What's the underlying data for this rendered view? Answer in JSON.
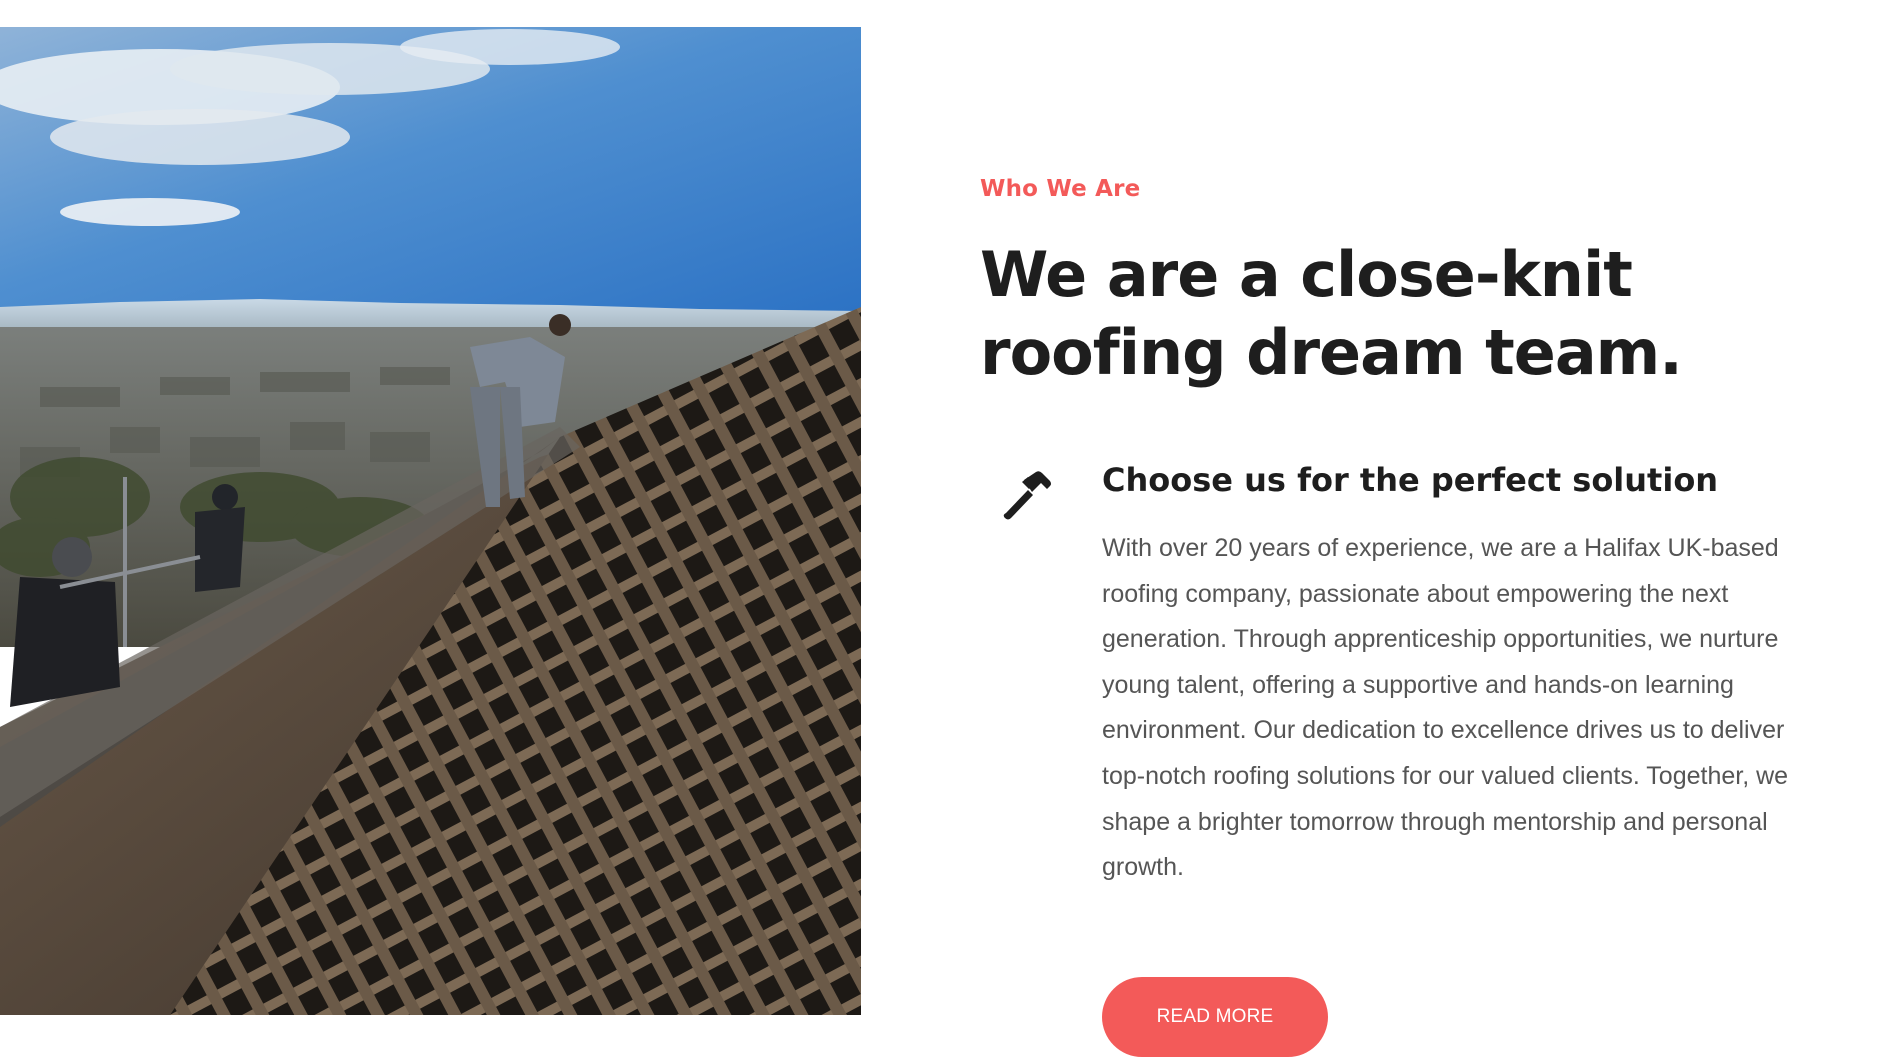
{
  "photo": {
    "icon": "roofers-on-roof-photo"
  },
  "about": {
    "eyebrow": "Who We Are",
    "headline_line1": "We are a close-knit",
    "headline_line2": "roofing dream team.",
    "feature": {
      "icon": "hammer-icon",
      "title": "Choose us for the perfect solution",
      "text": "With over 20 years of experience, we are a Halifax UK-based roofing company, passionate about empowering the next generation. Through apprenticeship opportunities, we nurture young talent, offering a supportive and hands-on learning environment. Our dedication to excellence drives us to deliver top-notch roofing solutions for our valued clients. Together, we shape a brighter tomorrow through mentorship and personal growth."
    },
    "button_label": "READ MORE"
  },
  "colors": {
    "accent": "#f35a59",
    "heading": "#1e1e1e",
    "body_text": "#555555"
  }
}
